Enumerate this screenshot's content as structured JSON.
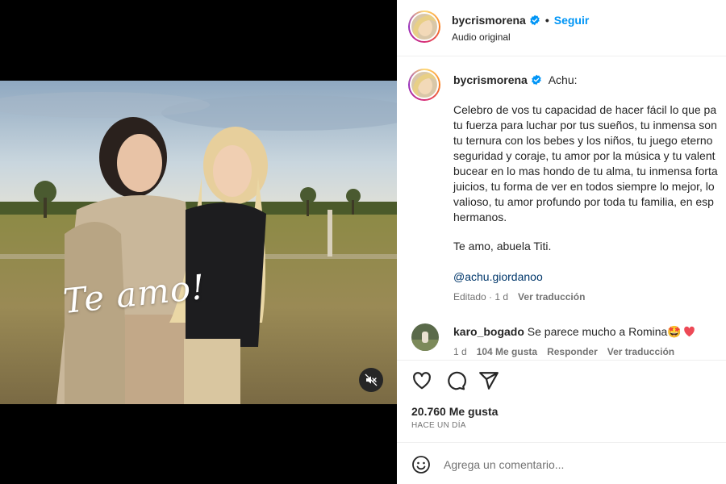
{
  "post": {
    "username": "bycrismorena",
    "follow_label": "Seguir",
    "audio_label": "Audio original",
    "overlay_text": "Te amo!"
  },
  "caption": {
    "username": "bycrismorena",
    "title": "Achu:",
    "body": "Celebro de vos tu capacidad de hacer fácil lo que pa\ntu fuerza para luchar por tus sueños, tu inmensa son\ntu ternura con los bebes y los niños, tu juego eterno\nseguridad y coraje, tu amor por la música y tu valent\nbucear en lo mas hondo de tu alma, tu inmensa forta\njuicios, tu forma de ver en todos siempre lo mejor, lo\nvalioso, tu amor profundo por toda tu familia, en esp\nhermanos.",
    "signoff": "Te amo, abuela Titi.",
    "mention": "@achu.giordanoo",
    "edited": "Editado · 1 d",
    "see_translation": "Ver traducción"
  },
  "comment": {
    "username": "karo_bogado",
    "text": "Se parece mucho a Romina🤩",
    "time": "1 d",
    "likes": "104 Me gusta",
    "reply": "Responder",
    "see_translation": "Ver traducción"
  },
  "footer": {
    "likes": "20.760 Me gusta",
    "time": "HACE UN DÍA",
    "comment_placeholder": "Agrega un comentario..."
  },
  "icons": [
    "verified-badge-icon",
    "mute-icon",
    "heart-icon",
    "comment-icon",
    "share-icon",
    "emoji-icon",
    "red-heart-icon"
  ],
  "colors": {
    "accent": "#0095f6",
    "link": "#00376b",
    "muted": "#737373",
    "heart": "#ed4956"
  }
}
